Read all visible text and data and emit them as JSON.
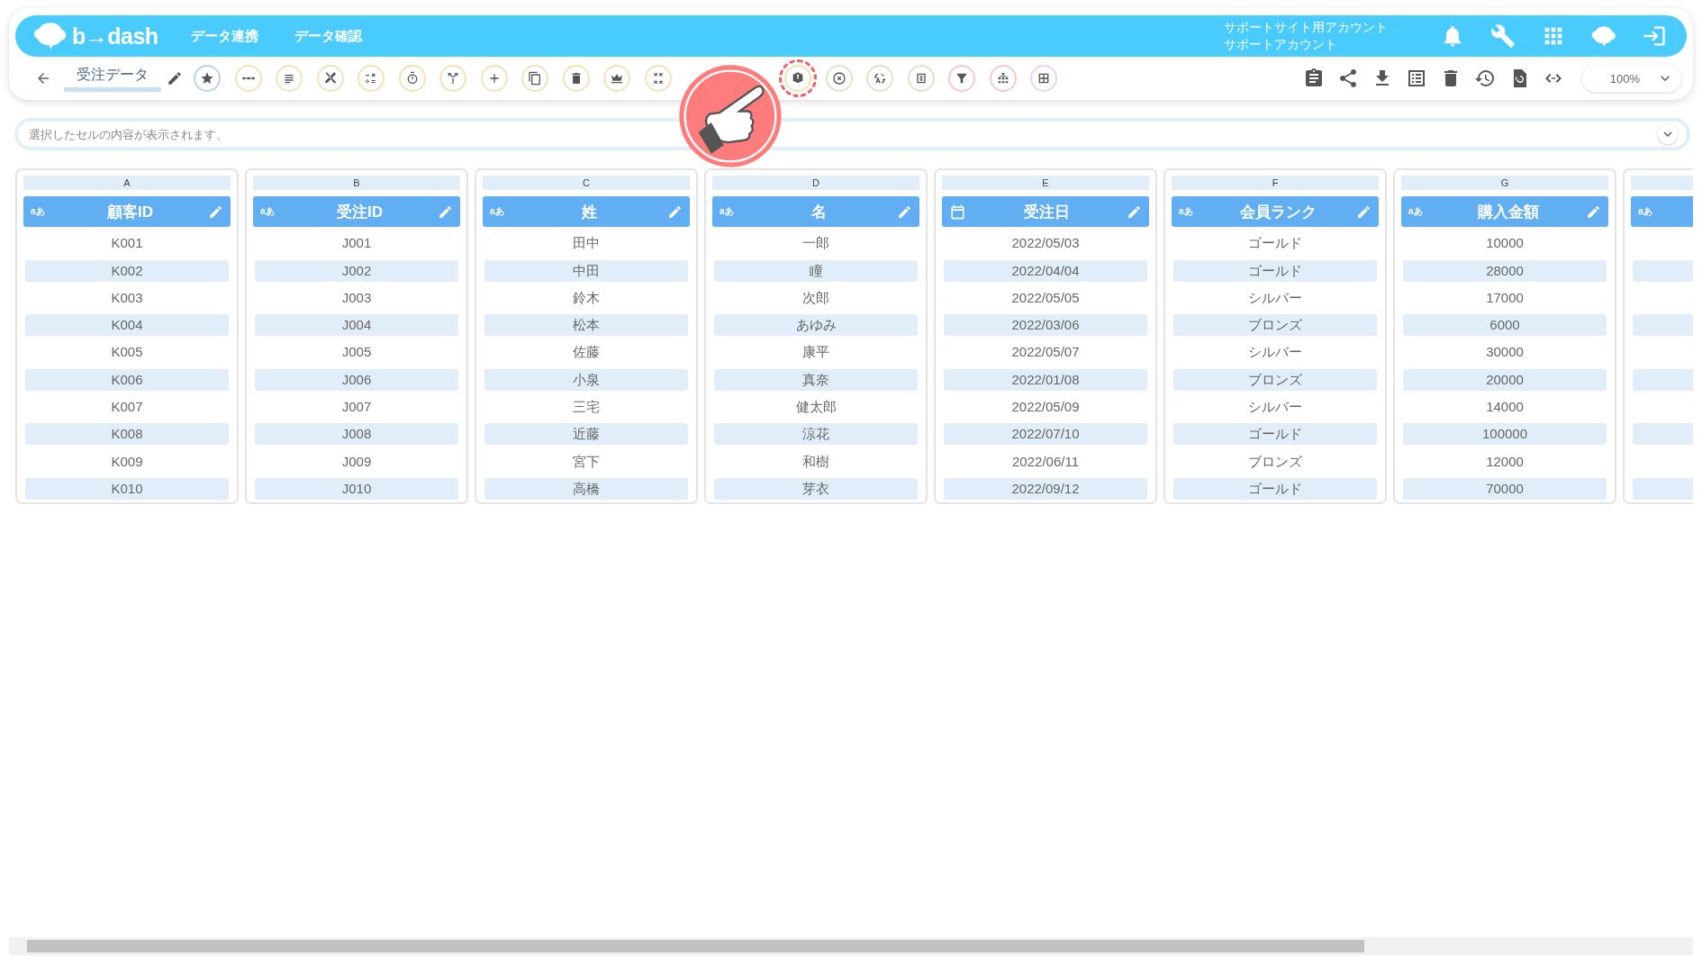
{
  "header": {
    "logo": "b→dash",
    "nav": [
      {
        "label": "データ連携"
      },
      {
        "label": "データ確認"
      }
    ],
    "account": [
      "サポートサイト用アカウント",
      "サポートアカウント"
    ]
  },
  "toolbar": {
    "title": "受注データ",
    "tools": [
      {
        "kind": "star",
        "color": "#b9d3ee",
        "highlighted": false
      },
      {
        "kind": "dots",
        "color": "#f2e2b6",
        "highlighted": false
      },
      {
        "kind": "lines",
        "color": "#f2e2b6",
        "highlighted": false
      },
      {
        "kind": "tools",
        "color": "#f2e2b6",
        "highlighted": false
      },
      {
        "kind": "calc",
        "color": "#f2e2b6",
        "highlighted": false
      },
      {
        "kind": "timer",
        "color": "#f2e2b6",
        "highlighted": false
      },
      {
        "kind": "split",
        "color": "#f2e2b6",
        "highlighted": false
      },
      {
        "kind": "plus",
        "color": "#f2e2b6",
        "highlighted": false
      },
      {
        "kind": "copy",
        "color": "#f2e2b6",
        "highlighted": false
      },
      {
        "kind": "trash",
        "color": "#f2e2b6",
        "highlighted": false
      },
      {
        "kind": "crown",
        "color": "#f2e2b6",
        "highlighted": false
      },
      {
        "kind": "compress",
        "color": "#f2e2b6",
        "highlighted": false
      },
      {
        "kind": "box",
        "color": "#f2e2b6",
        "highlighted": true,
        "covered_before": true
      },
      {
        "kind": "cancel",
        "color": "#dde5c6",
        "highlighted": false
      },
      {
        "kind": "translate",
        "color": "#dde5c6",
        "highlighted": false
      },
      {
        "kind": "zero",
        "color": "#dde5c6",
        "highlighted": false
      },
      {
        "kind": "filter",
        "color": "#f7c9c9",
        "highlighted": false
      },
      {
        "kind": "group",
        "color": "#f7c9c9",
        "highlighted": false
      },
      {
        "kind": "grid",
        "color": "#ebd2f5",
        "highlighted": false
      }
    ],
    "zoom": "100%"
  },
  "formula_bar": {
    "placeholder": "選択したセルの内容が表示されます。"
  },
  "columns": [
    {
      "letter": "A",
      "kind": "text",
      "type_label": "aあ",
      "title": "顧客ID",
      "cells": [
        "K001",
        "K002",
        "K003",
        "K004",
        "K005",
        "K006",
        "K007",
        "K008",
        "K009",
        "K010"
      ]
    },
    {
      "letter": "B",
      "kind": "text",
      "type_label": "aあ",
      "title": "受注ID",
      "cells": [
        "J001",
        "J002",
        "J003",
        "J004",
        "J005",
        "J006",
        "J007",
        "J008",
        "J009",
        "J010"
      ]
    },
    {
      "letter": "C",
      "kind": "text",
      "type_label": "aあ",
      "title": "姓",
      "cells": [
        "田中",
        "中田",
        "鈴木",
        "松本",
        "佐藤",
        "小泉",
        "三宅",
        "近藤",
        "宮下",
        "高橋"
      ]
    },
    {
      "letter": "D",
      "kind": "text",
      "type_label": "aあ",
      "title": "名",
      "cells": [
        "一郎",
        "瞳",
        "次郎",
        "あゆみ",
        "康平",
        "真奈",
        "健太郎",
        "涼花",
        "和樹",
        "芽衣"
      ]
    },
    {
      "letter": "E",
      "kind": "date",
      "title": "受注日",
      "cells": [
        "2022/05/03",
        "2022/04/04",
        "2022/05/05",
        "2022/03/06",
        "2022/05/07",
        "2022/01/08",
        "2022/05/09",
        "2022/07/10",
        "2022/06/11",
        "2022/09/12"
      ]
    },
    {
      "letter": "F",
      "kind": "text",
      "type_label": "aあ",
      "title": "会員ランク",
      "cells": [
        "ゴールド",
        "ゴールド",
        "シルバー",
        "ブロンズ",
        "シルバー",
        "ブロンズ",
        "シルバー",
        "ゴールド",
        "ブロンズ",
        "ゴールド"
      ]
    },
    {
      "letter": "G",
      "kind": "text",
      "type_label": "aあ",
      "title": "購入金額",
      "cells": [
        "10000",
        "28000",
        "17000",
        "6000",
        "30000",
        "20000",
        "14000",
        "100000",
        "12000",
        "70000"
      ]
    },
    {
      "kind": "text",
      "type_label": "aあ"
    }
  ]
}
